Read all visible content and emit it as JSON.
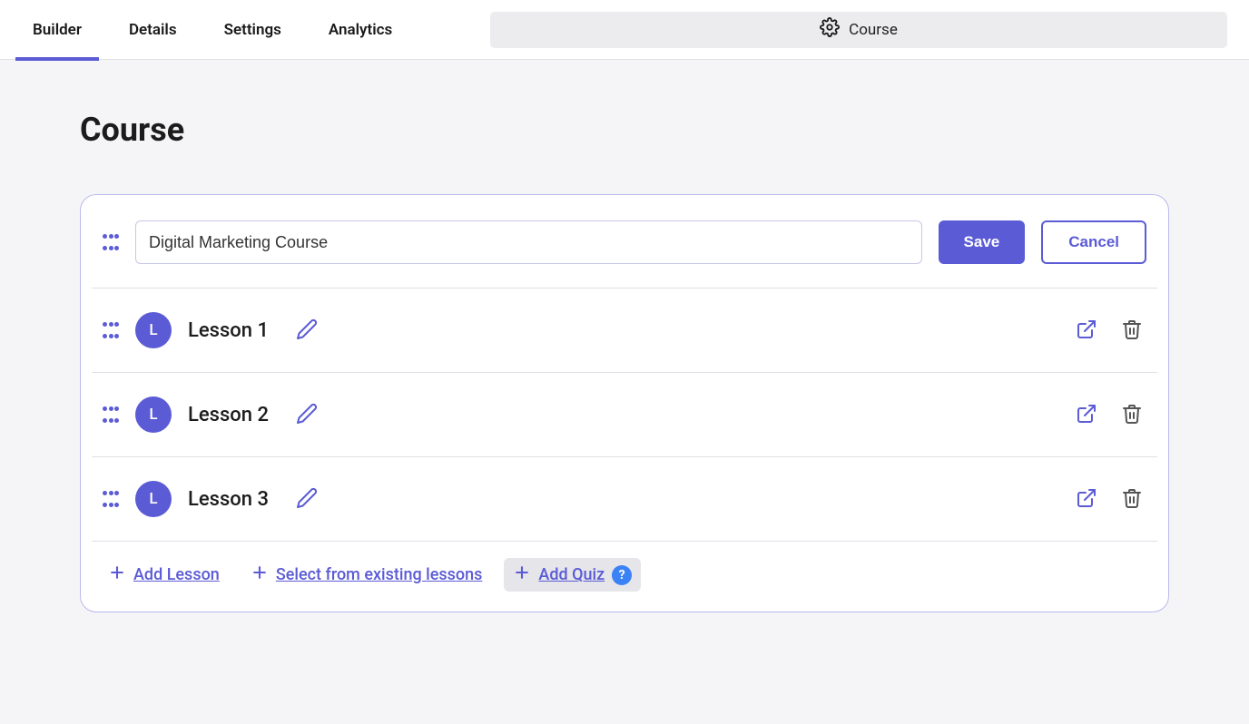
{
  "tabs": [
    "Builder",
    "Details",
    "Settings",
    "Analytics"
  ],
  "active_tab_index": 0,
  "course_pill_label": "Course",
  "page_title": "Course",
  "course_title_value": "Digital Marketing Course",
  "buttons": {
    "save": "Save",
    "cancel": "Cancel"
  },
  "lesson_avatar_letter": "L",
  "lessons": [
    {
      "title": "Lesson 1"
    },
    {
      "title": "Lesson 2"
    },
    {
      "title": "Lesson 3"
    }
  ],
  "footer": {
    "add_lesson": "Add Lesson",
    "select_existing": "Select from existing lessons",
    "add_quiz": "Add Quiz"
  },
  "help_badge": "?"
}
